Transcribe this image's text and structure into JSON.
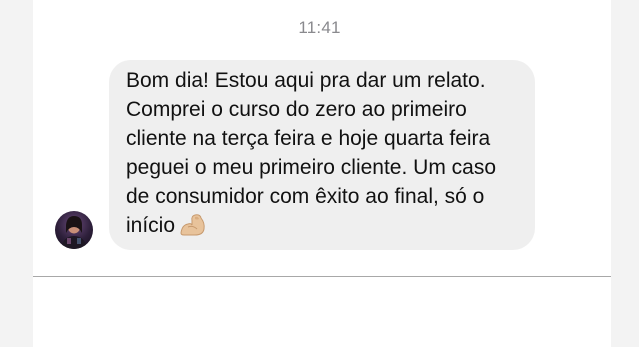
{
  "conversation": {
    "timestamp": "11:41",
    "message": {
      "lines": [
        "Bom dia! Estou aqui pra dar um relato.",
        "Comprei o curso do zero ao primeiro",
        "cliente na terça feira e hoje quarta feira",
        "peguei o meu primeiro cliente. Um caso",
        "de consumidor com êxito ao final, só o",
        "início"
      ],
      "emoji": "flexed-biceps-icon"
    },
    "avatar": "avatar"
  },
  "colors": {
    "bubble": "#efefef",
    "text": "#111111",
    "timestamp": "#8a8a8e",
    "divider": "#a8a8a8"
  }
}
